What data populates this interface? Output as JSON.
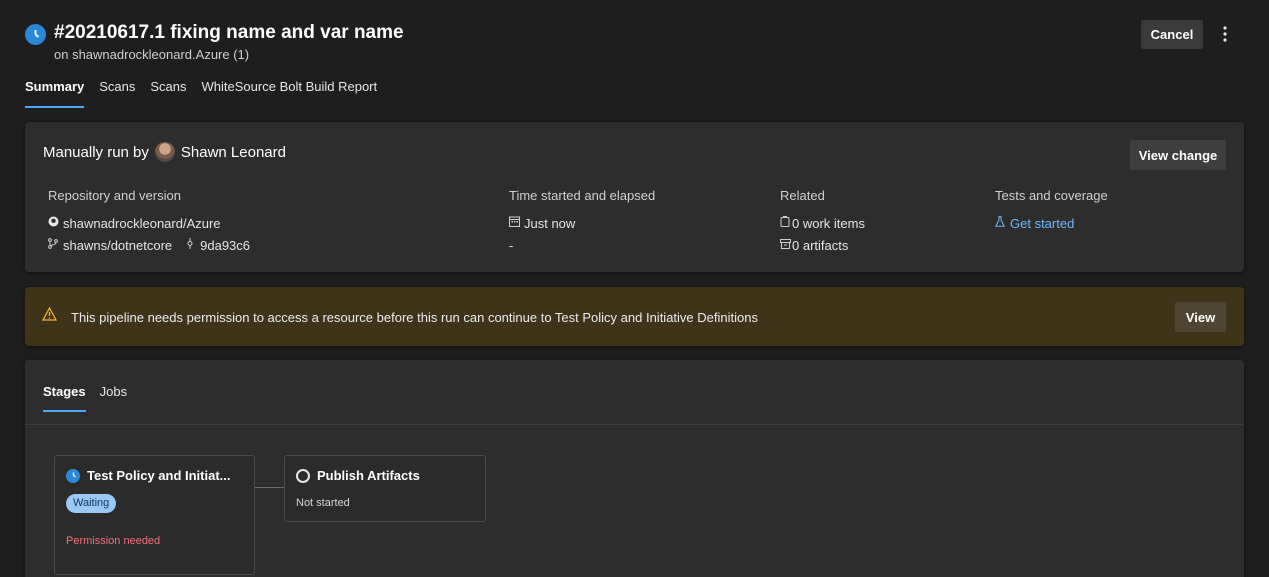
{
  "header": {
    "title": "#20210617.1 fixing name and var name",
    "subtitle": "on shawnadrockleonard.Azure (1)",
    "cancel_label": "Cancel",
    "more_icon": "more-vertical-icon"
  },
  "tabs": [
    {
      "label": "Summary",
      "active": true
    },
    {
      "label": "Scans",
      "active": false
    },
    {
      "label": "Scans",
      "active": false
    },
    {
      "label": "WhiteSource Bolt Build Report",
      "active": false
    }
  ],
  "summary": {
    "run_by_prefix": "Manually run by",
    "run_by_user": "Shawn Leonard",
    "view_change_label": "View change",
    "repository": {
      "label": "Repository and version",
      "repo": "shawnadrockleonard/Azure",
      "branch": "shawns/dotnetcore",
      "commit": "9da93c6"
    },
    "time": {
      "label": "Time started and elapsed",
      "started": "Just now",
      "elapsed": "-"
    },
    "related": {
      "label": "Related",
      "work_items": "0 work items",
      "artifacts": "0 artifacts"
    },
    "tests": {
      "label": "Tests and coverage",
      "link": "Get started"
    }
  },
  "warning": {
    "message": "This pipeline needs permission to access a resource before this run can continue to Test Policy and Initiative Definitions",
    "view_label": "View"
  },
  "stages": {
    "tabs": [
      {
        "label": "Stages",
        "active": true
      },
      {
        "label": "Jobs",
        "active": false
      }
    ],
    "items": [
      {
        "name": "Test Policy and Initiat...",
        "badge": "Waiting",
        "note": "Permission needed"
      },
      {
        "name": "Publish Artifacts",
        "status": "Not started"
      }
    ]
  },
  "colors": {
    "accent": "#2b88d8",
    "link": "#6cb8ff",
    "warning_bg": "#3f3419",
    "error": "#f1707b"
  }
}
